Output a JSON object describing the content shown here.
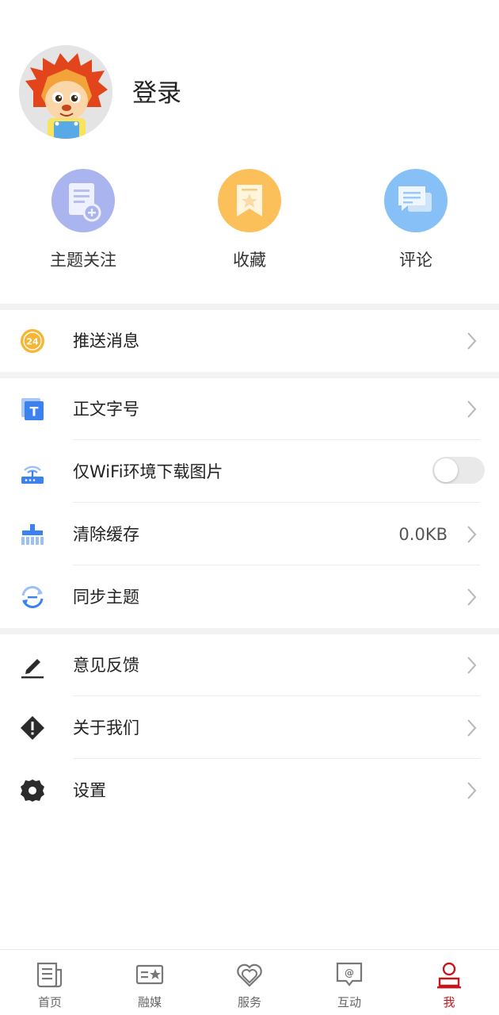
{
  "profile": {
    "login_label": "登录"
  },
  "quick_actions": [
    {
      "label": "主题关注",
      "icon": "topic-follow-icon",
      "color": "#aab4ee"
    },
    {
      "label": "收藏",
      "icon": "favorite-icon",
      "color": "#fcc05a"
    },
    {
      "label": "评论",
      "icon": "comment-icon",
      "color": "#87c0f7"
    }
  ],
  "menu": {
    "push": {
      "label": "推送消息",
      "icon": "push-24-icon"
    },
    "font_size": {
      "label": "正文字号",
      "icon": "text-size-icon"
    },
    "wifi_images": {
      "label": "仅WiFi环境下载图片",
      "icon": "wifi-router-icon",
      "enabled": false
    },
    "clear_cache": {
      "label": "清除缓存",
      "icon": "broom-icon",
      "value": "0.0KB"
    },
    "sync_topics": {
      "label": "同步主题",
      "icon": "sync-icon"
    },
    "feedback": {
      "label": "意见反馈",
      "icon": "pen-icon"
    },
    "about": {
      "label": "关于我们",
      "icon": "info-diamond-icon"
    },
    "settings": {
      "label": "设置",
      "icon": "gear-icon"
    }
  },
  "tabbar": {
    "active": "我",
    "items": [
      {
        "label": "首页",
        "icon": "news-icon"
      },
      {
        "label": "融媒",
        "icon": "media-icon"
      },
      {
        "label": "服务",
        "icon": "heart-service-icon"
      },
      {
        "label": "互动",
        "icon": "chat-at-icon"
      },
      {
        "label": "我",
        "icon": "person-icon"
      }
    ]
  },
  "colors": {
    "accent": "#c8161d",
    "separator": "#f2f2f2",
    "icon_blue": "#3b82f0"
  }
}
